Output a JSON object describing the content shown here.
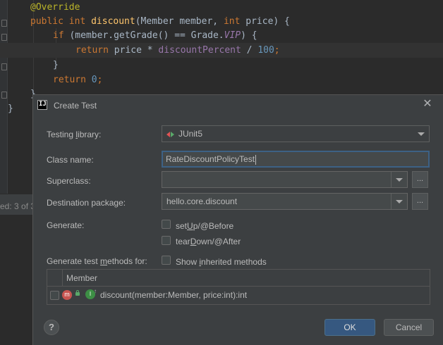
{
  "editor": {
    "lines": {
      "l1": "@Override",
      "l2_kw1": "public int ",
      "l2_fn": "discount",
      "l2_rest1": "(Member member, ",
      "l2_kw2": "int ",
      "l2_rest2": "price) {",
      "l3_kw": "if ",
      "l3_rest1": "(member.getGrade() == Grade.",
      "l3_const": "VIP",
      "l3_rest2": ") {",
      "l4_kw": "return ",
      "l4_rest1": "price * ",
      "l4_field": "discountPercent",
      "l4_rest2": " / ",
      "l4_num": "100",
      "l4_end": ";",
      "l5": "}",
      "l6_kw": "return ",
      "l6_num": "0",
      "l6_end": ";",
      "l7": "}",
      "l8": "}"
    },
    "status_text": "ed: 3 of 3"
  },
  "dialog": {
    "title": "Create Test",
    "close_icon": "close-icon",
    "testing_library": {
      "label_pre": "Testing ",
      "label_u": "l",
      "label_post": "ibrary:",
      "value": "JUnit5"
    },
    "class_name": {
      "label": "Class name:",
      "value": "RateDiscountPolicyTest"
    },
    "superclass": {
      "label": "Superclass:",
      "value": "",
      "browse": "..."
    },
    "destination": {
      "label": "Destination package:",
      "value": "hello.core.discount",
      "browse": "..."
    },
    "generate": {
      "label": "Generate:",
      "setup_pre": "set",
      "setup_u": "U",
      "setup_post": "p/@Before",
      "teardown_pre": "tear",
      "teardown_u": "D",
      "teardown_post": "own/@After"
    },
    "test_methods": {
      "label_pre": "Generate test ",
      "label_u": "m",
      "label_post": "ethods for:",
      "show_pre": "Show ",
      "show_u": "i",
      "show_post": "nherited methods"
    },
    "table": {
      "header": "Member",
      "rows": [
        {
          "icon": "m",
          "text": "discount(member:Member, price:int):int"
        }
      ]
    },
    "buttons": {
      "help": "?",
      "ok": "OK",
      "cancel": "Cancel"
    },
    "colors": {
      "ok_button": "#365880",
      "focus_border": "#3d6185",
      "background": "#3c3f41"
    }
  }
}
